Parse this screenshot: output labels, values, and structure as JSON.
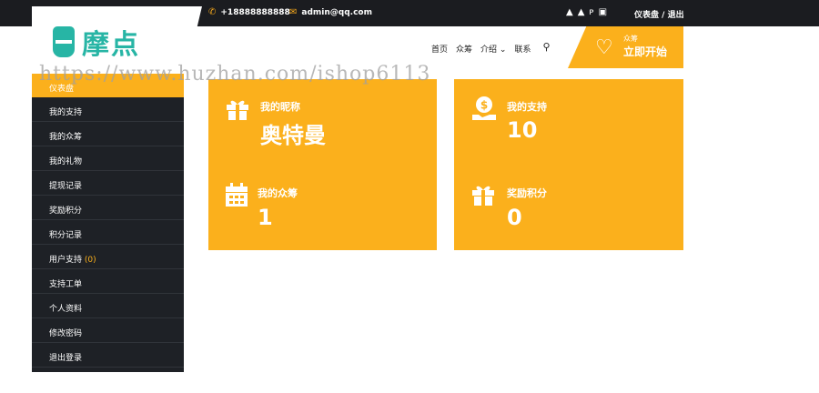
{
  "topbar": {
    "phone": "+18888888888",
    "email": "admin@qq.com",
    "dashboard_link": "仪表盘",
    "separator": "/",
    "logout_link": "退出"
  },
  "logo": {
    "text": "摩点"
  },
  "nav": {
    "items": [
      "首页",
      "众筹",
      "介绍",
      "联系"
    ]
  },
  "cta": {
    "small": "众筹",
    "big": "立即开始"
  },
  "watermark": "https://www.huzhan.com/ishop6113",
  "sidebar": {
    "active": "仪表盘",
    "items": [
      {
        "label": "我的支持"
      },
      {
        "label": "我的众筹"
      },
      {
        "label": "我的礼物"
      },
      {
        "label": "提现记录"
      },
      {
        "label": "奖励积分"
      },
      {
        "label": "积分记录"
      },
      {
        "label": "用户支持",
        "count": "(0)"
      },
      {
        "label": "支持工单"
      },
      {
        "label": "个人资料"
      },
      {
        "label": "修改密码"
      },
      {
        "label": "退出登录"
      }
    ]
  },
  "stats": {
    "nickname_label": "我的昵称",
    "nickname_value": "奥特曼",
    "support_label": "我的支持",
    "support_value": "10",
    "crowd_label": "我的众筹",
    "crowd_value": "1",
    "points_label": "奖励积分",
    "points_value": "0"
  },
  "colors": {
    "accent": "#fbb01c",
    "sidebar": "#1e2126",
    "topbar": "#1b1c20",
    "logo": "#27b5a5"
  }
}
